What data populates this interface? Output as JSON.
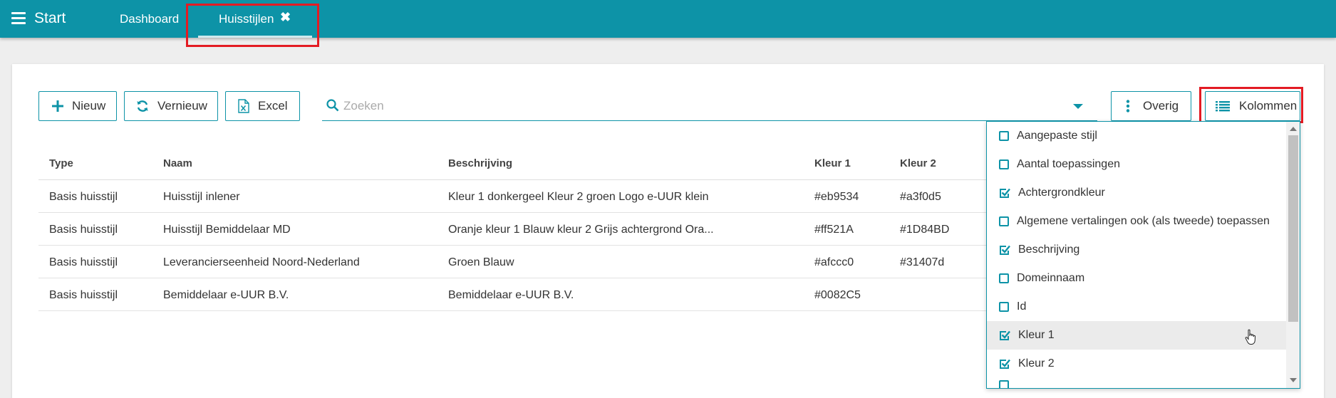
{
  "header": {
    "app_title": "Start",
    "tabs": [
      {
        "label": "Dashboard"
      },
      {
        "label": "Huisstijlen"
      }
    ],
    "accent_color": "#0d93a7",
    "highlight_color": "#e31b23"
  },
  "toolbar": {
    "new_label": "Nieuw",
    "refresh_label": "Vernieuw",
    "excel_label": "Excel",
    "search_placeholder": "Zoeken",
    "other_label": "Overig",
    "columns_label": "Kolommen"
  },
  "table": {
    "columns": [
      "Type",
      "Naam",
      "Beschrijving",
      "Kleur 1",
      "Kleur 2"
    ],
    "rows": [
      {
        "type": "Basis huisstijl",
        "naam": "Huisstijl inlener",
        "beschrijving": "Kleur 1 donkergeel Kleur 2 groen Logo e-UUR klein",
        "kleur1": "#eb9534",
        "kleur2": "#a3f0d5"
      },
      {
        "type": "Basis huisstijl",
        "naam": "Huisstijl Bemiddelaar MD",
        "beschrijving": "Oranje kleur 1 Blauw kleur 2 Grijs achtergrond Ora...",
        "kleur1": "#ff521A",
        "kleur2": "#1D84BD"
      },
      {
        "type": "Basis huisstijl",
        "naam": "Leverancierseenheid Noord-Nederland",
        "beschrijving": "Groen Blauw",
        "kleur1": "#afccc0",
        "kleur2": "#31407d"
      },
      {
        "type": "Basis huisstijl",
        "naam": "Bemiddelaar e-UUR B.V.",
        "beschrijving": "Bemiddelaar e-UUR B.V.",
        "kleur1": "#0082C5",
        "kleur2": ""
      }
    ]
  },
  "columns_menu": {
    "items": [
      {
        "label": "Aangepaste stijl",
        "checked": false
      },
      {
        "label": "Aantal toepassingen",
        "checked": false
      },
      {
        "label": "Achtergrondkleur",
        "checked": true
      },
      {
        "label": "Algemene vertalingen ook (als tweede) toepassen",
        "checked": false
      },
      {
        "label": "Beschrijving",
        "checked": true
      },
      {
        "label": "Domeinnaam",
        "checked": false
      },
      {
        "label": "Id",
        "checked": false
      },
      {
        "label": "Kleur 1",
        "checked": true
      },
      {
        "label": "Kleur 2",
        "checked": true
      }
    ]
  }
}
